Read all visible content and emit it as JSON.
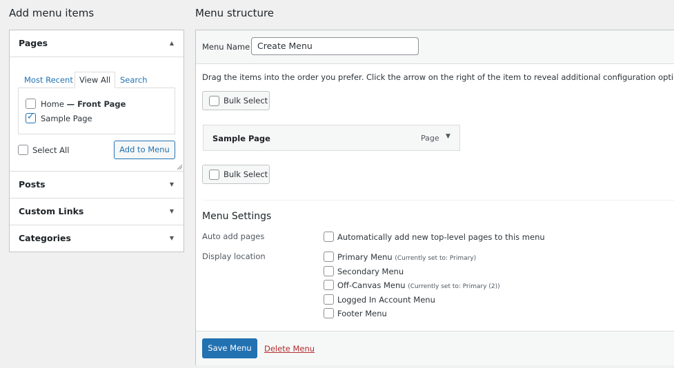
{
  "left": {
    "title": "Add menu items",
    "sections": {
      "pages": {
        "label": "Pages"
      },
      "posts": {
        "label": "Posts"
      },
      "custom_links": {
        "label": "Custom Links"
      },
      "categories": {
        "label": "Categories"
      }
    },
    "tabs": {
      "most_recent": "Most Recent",
      "view_all": "View All",
      "search": "Search"
    },
    "pages_list": [
      {
        "label": "Home",
        "suffix": "— Front Page",
        "checked": false
      },
      {
        "label": "Sample Page",
        "checked": true
      }
    ],
    "select_all": "Select All",
    "add_to_menu": "Add to Menu"
  },
  "main": {
    "title": "Menu structure",
    "menu_name_label": "Menu Name",
    "menu_name_value": "Create Menu",
    "instructions": "Drag the items into the order you prefer. Click the arrow on the right of the item to reveal additional configuration options.",
    "bulk_select": "Bulk Select",
    "menu_item": {
      "title": "Sample Page",
      "type": "Page"
    },
    "settings": {
      "heading": "Menu Settings",
      "auto_add_label": "Auto add pages",
      "auto_add_option": "Automatically add new top-level pages to this menu",
      "display_location_label": "Display location",
      "locations": [
        {
          "label": "Primary Menu",
          "note": "(Currently set to: Primary)"
        },
        {
          "label": "Secondary Menu",
          "note": ""
        },
        {
          "label": "Off-Canvas Menu",
          "note": "(Currently set to: Primary (2))"
        },
        {
          "label": "Logged In Account Menu",
          "note": ""
        },
        {
          "label": "Footer Menu",
          "note": ""
        }
      ]
    },
    "save_menu": "Save Menu",
    "delete_menu": "Delete Menu"
  }
}
